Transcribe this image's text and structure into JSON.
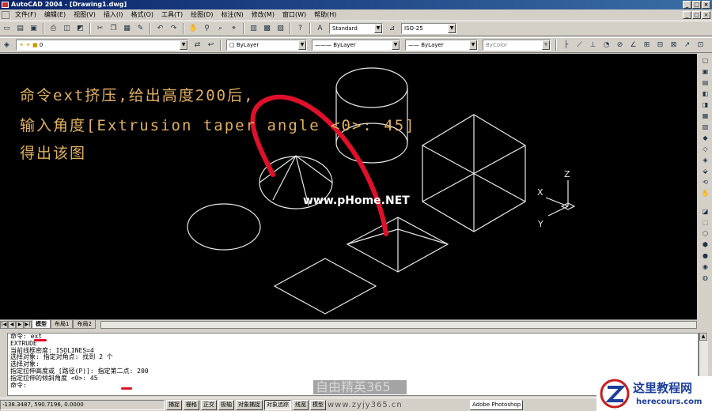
{
  "window": {
    "title": "AutoCAD 2004 - [Drawing1.dwg]",
    "controls": [
      "_",
      "□",
      "×"
    ]
  },
  "menu": [
    "文件(F)",
    "编辑(E)",
    "视图(V)",
    "插入(I)",
    "格式(O)",
    "工具(T)",
    "绘图(D)",
    "标注(N)",
    "修改(M)",
    "窗口(W)",
    "帮助(H)"
  ],
  "toolbar": {
    "text_style": "Standard",
    "dim_style": "ISO-25"
  },
  "layers": {
    "current_layer": "0",
    "color": "ByLayer",
    "linetype": "ByLayer",
    "lineweight": "ByLayer",
    "plot_style": "ByColor"
  },
  "overlay": {
    "line1": "命令ext挤压,给出高度200后,",
    "line2": "输入角度[Extrusion taper angle <0>: 45]",
    "line3": "得出该图",
    "watermark": "www.pHome.NET"
  },
  "ucs": {
    "x": "X",
    "y": "Y",
    "z": "Z"
  },
  "tabs": {
    "model": "模型",
    "layout1": "布局1",
    "layout2": "布局2"
  },
  "command_lines": [
    "命令: ext",
    "EXTRUDE",
    "当前线框密度:  ISOLINES=4",
    "选择对象: 指定对角点: 找到 2 个",
    "选择对象:",
    "指定拉伸高度或 [路径(P)]: 指定第二点: 200",
    "指定拉伸的倾斜角度 <0>: 45",
    "命令:"
  ],
  "status": {
    "coords": "-138.3487, 590.7196, 0.0000",
    "buttons": [
      "捕捉",
      "栅格",
      "正交",
      "极轴",
      "对象捕捉",
      "对象追踪",
      "线宽",
      "模型"
    ],
    "taskbar_item": "Adobe Photoshop"
  },
  "watermarks": {
    "zyjy_title": "自由精英365",
    "zyjy_url": "www.zyjy365.cn",
    "herecours_title": "这里教程网",
    "herecours_url": "herecours.com"
  },
  "colors": {
    "canvas": "#000000",
    "overlay_text": "#e0b060",
    "annotation": "#e0102a",
    "chrome": "#d4d0c8"
  }
}
